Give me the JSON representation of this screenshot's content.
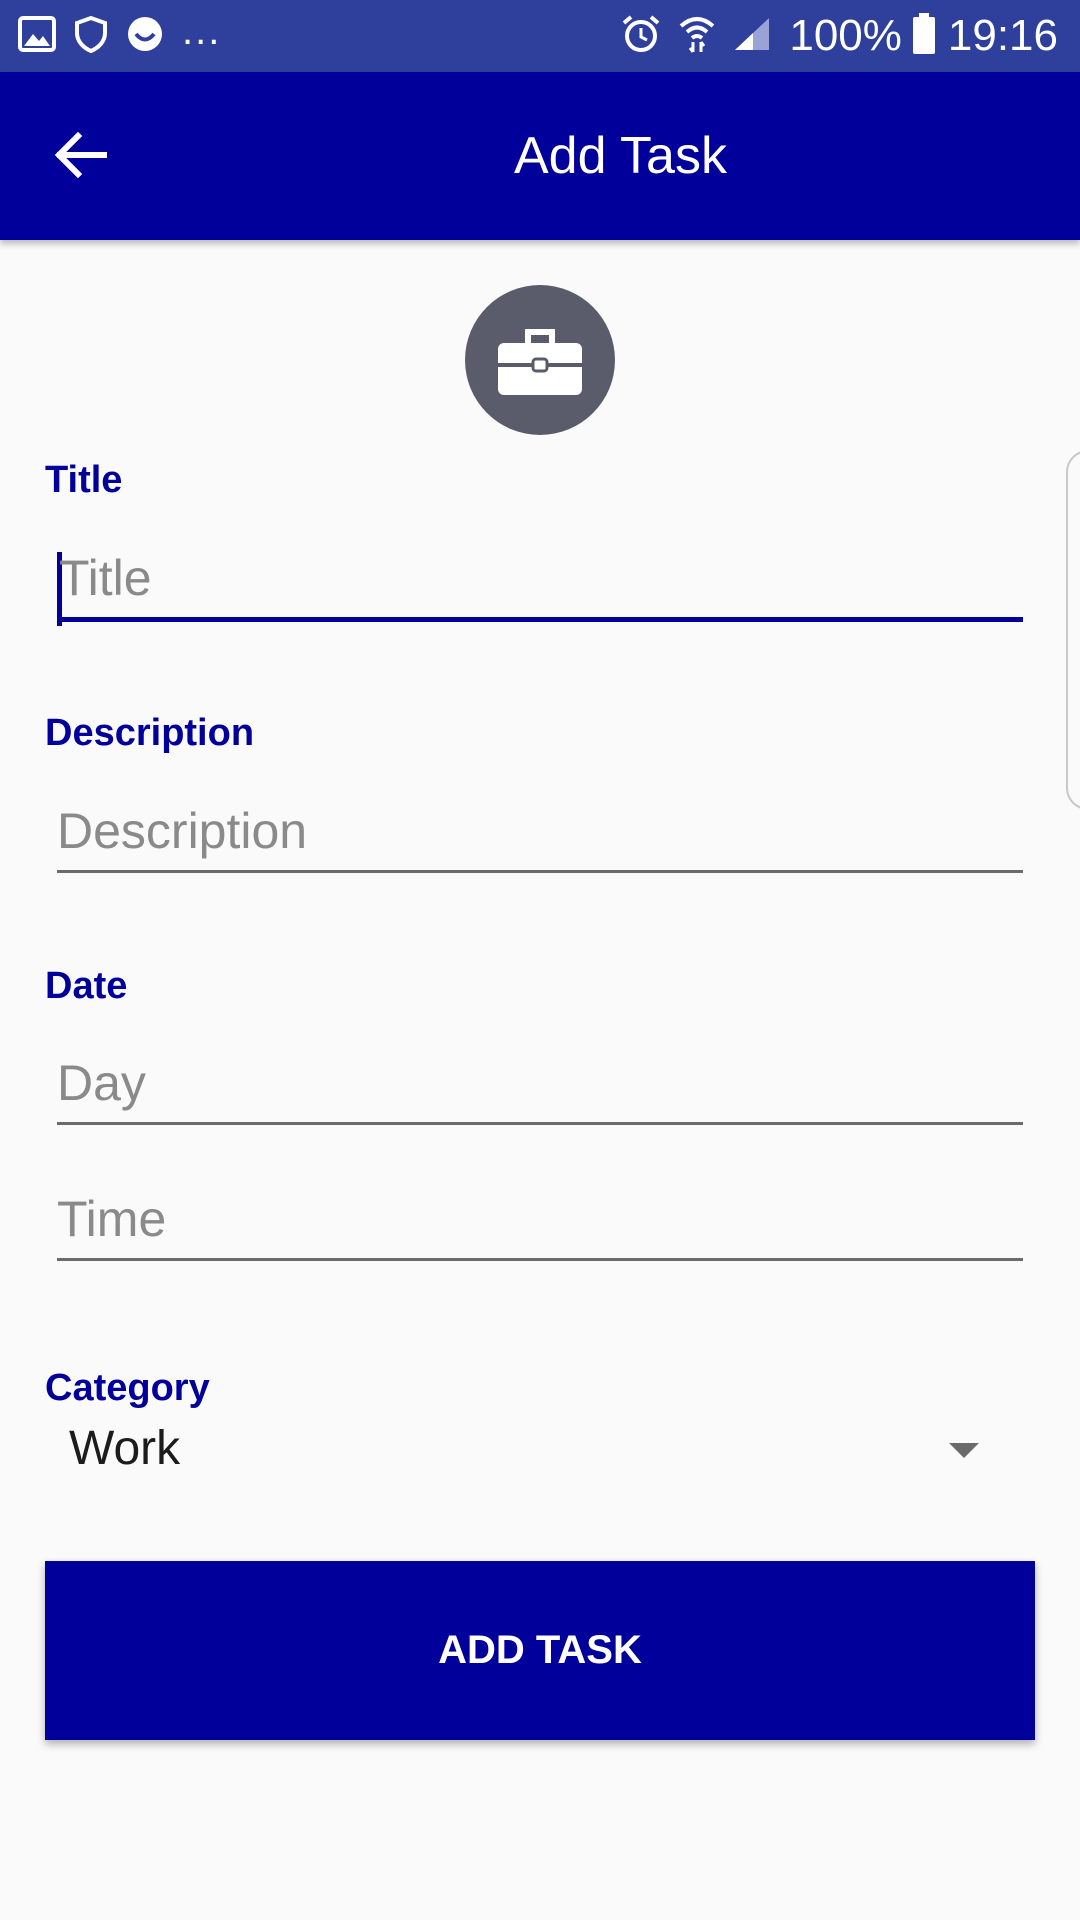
{
  "status_bar": {
    "left_icons": [
      "image-icon",
      "shield-icon",
      "smiley-icon"
    ],
    "more": "...",
    "right_icons": [
      "alarm-icon",
      "wifi-icon",
      "signal-icon",
      "battery-icon"
    ],
    "battery": "100%",
    "time": "19:16"
  },
  "app_bar": {
    "back_icon": "arrow-left-icon",
    "title": "Add Task"
  },
  "avatar": {
    "icon": "briefcase-icon",
    "color": "#5b5c6b"
  },
  "form": {
    "title": {
      "label": "Title",
      "placeholder": "Title",
      "value": ""
    },
    "description": {
      "label": "Description",
      "placeholder": "Description",
      "value": ""
    },
    "date": {
      "label": "Date",
      "day_placeholder": "Day",
      "time_placeholder": "Time"
    },
    "category": {
      "label": "Category",
      "selected": "Work"
    }
  },
  "button": {
    "label": "ADD TASK"
  },
  "colors": {
    "status_bar": "#2f3f9c",
    "app_bar": "#01009a",
    "accent": "#01009a",
    "background": "#fafafa"
  }
}
